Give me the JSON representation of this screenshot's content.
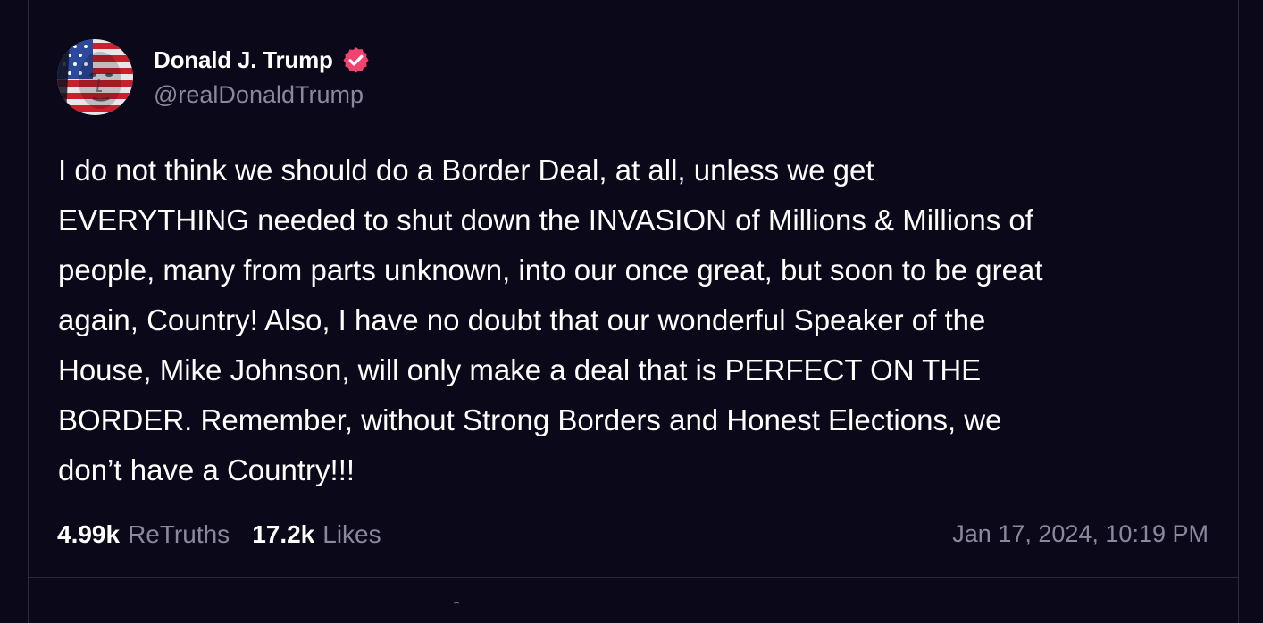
{
  "post": {
    "author": {
      "display_name": "Donald J. Trump",
      "handle": "@realDonaldTrump",
      "verified": true,
      "avatar_icon": "flag-painted-face-avatar"
    },
    "body_lines": [
      "I do not think we should do a Border Deal, at all, unless we get",
      "EVERYTHING needed to shut down the INVASION of Millions & Millions of",
      "people, many from parts unknown, into our once great, but soon to be great",
      "again, Country! Also, I have no doubt that our wonderful Speaker of the",
      "House, Mike Johnson, will only make a deal that is PERFECT ON THE",
      "BORDER. Remember, without Strong Borders and Honest Elections, we",
      "don’t have a Country!!!"
    ],
    "stats": {
      "retruths_count": "4.99k",
      "retruths_label": "ReTruths",
      "likes_count": "17.2k",
      "likes_label": "Likes"
    },
    "timestamp": "Jan 17, 2024, 10:19 PM"
  },
  "colors": {
    "background": "#0b0819",
    "border": "#2c2840",
    "text_primary": "#ffffff",
    "text_secondary": "#8b879e",
    "verified_badge": "#f0436f"
  }
}
